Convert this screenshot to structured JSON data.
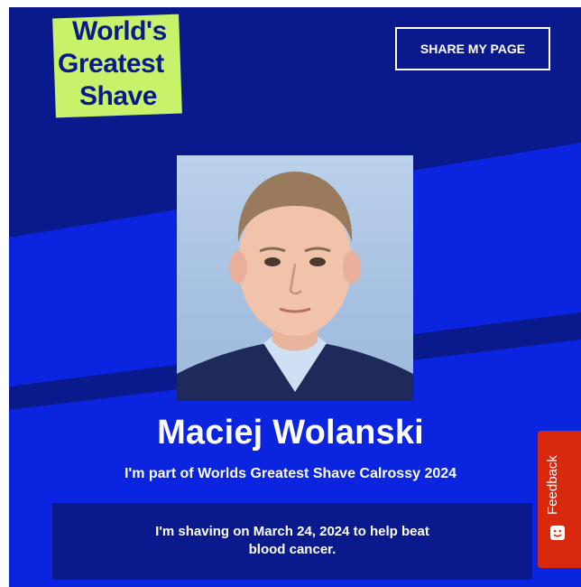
{
  "logo": {
    "lines": [
      "World's",
      "Greatest",
      "Shave"
    ]
  },
  "header": {
    "share_label": "SHARE MY PAGE"
  },
  "profile": {
    "photo_icon": "profile-photo",
    "name": "Maciej Wolanski",
    "subtitle": "I'm part of Worlds Greatest Shave Calrossy 2024",
    "shave_line1": "I'm shaving on March 24, 2024 to help beat",
    "shave_line2": "blood cancer."
  },
  "feedback": {
    "label": "Feedback",
    "icon": "smiley-icon"
  },
  "colors": {
    "background": "#0a1a8c",
    "accent_band": "#0a24e0",
    "logo_green": "#c8f26a",
    "feedback_red": "#d8290f"
  }
}
